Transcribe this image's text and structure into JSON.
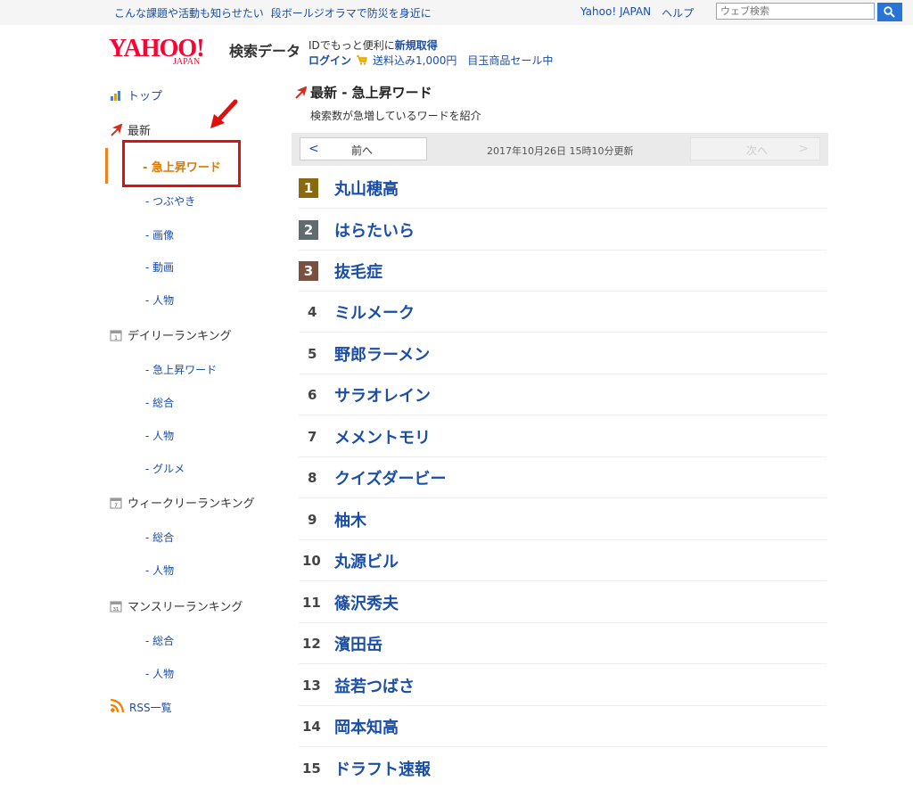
{
  "topbar": {
    "news": [
      "こんな課題や活動も知らせたい",
      "段ボールジオラマで防災を身近に"
    ],
    "links": [
      "Yahoo! JAPAN",
      "ヘルプ"
    ],
    "search_placeholder": "ウェブ検索"
  },
  "header": {
    "logo_text": "YAHOO!",
    "logo_sub": "JAPAN",
    "site_name": "検索データ",
    "promo_prefix": "IDでもっと便利に",
    "promo_link": "新規取得",
    "login": "ログイン",
    "shipping": "送料込み1,000円",
    "sale": "目玉商品セール中"
  },
  "sidebar": {
    "top": "トップ",
    "latest": "最新",
    "latest_items": [
      "- 急上昇ワード",
      "- つぶやき",
      "- 画像",
      "- 動画",
      "- 人物"
    ],
    "daily": "デイリーランキング",
    "daily_items": [
      "- 急上昇ワード",
      "- 総合",
      "- 人物",
      "- グルメ"
    ],
    "weekly": "ウィークリーランキング",
    "weekly_items": [
      "- 総合",
      "- 人物"
    ],
    "monthly": "マンスリーランキング",
    "monthly_items": [
      "- 総合",
      "- 人物"
    ],
    "rss": "RSS一覧"
  },
  "main": {
    "title": "最新 - 急上昇ワード",
    "description": "検索数が急増しているワードを紹介",
    "pager": {
      "prev_arrow": "<",
      "prev_label": "前へ",
      "updated": "2017年10月26日 15時10分更新",
      "next_label": "次へ",
      "next_arrow": ">"
    },
    "ranking": [
      {
        "rank": "1",
        "word": "丸山穂高",
        "badge": "#8a6a10"
      },
      {
        "rank": "2",
        "word": "はらたいら",
        "badge": "#5f6b6f"
      },
      {
        "rank": "3",
        "word": "抜毛症",
        "badge": "#7a5040"
      },
      {
        "rank": "4",
        "word": "ミルメーク"
      },
      {
        "rank": "5",
        "word": "野郎ラーメン"
      },
      {
        "rank": "6",
        "word": "サラオレイン"
      },
      {
        "rank": "7",
        "word": "メメントモリ"
      },
      {
        "rank": "8",
        "word": "クイズダービー"
      },
      {
        "rank": "9",
        "word": "柚木"
      },
      {
        "rank": "10",
        "word": "丸源ビル"
      },
      {
        "rank": "11",
        "word": "篠沢秀夫"
      },
      {
        "rank": "12",
        "word": "濱田岳"
      },
      {
        "rank": "13",
        "word": "益若つばさ"
      },
      {
        "rank": "14",
        "word": "岡本知高"
      },
      {
        "rank": "15",
        "word": "ドラフト速報"
      }
    ]
  },
  "colors": {
    "link": "#1a4ea8",
    "active": "#e07800",
    "highlight": "#e01010"
  },
  "icons": {
    "top": "house-chart-icon",
    "latest": "trend-up-arrow-icon",
    "daily": "calendar-1-icon",
    "weekly": "calendar-7-icon",
    "monthly": "calendar-31-icon",
    "rss": "rss-icon",
    "search": "search-icon",
    "cart": "cart-icon",
    "annotation": "red-pointer-arrow-icon"
  }
}
